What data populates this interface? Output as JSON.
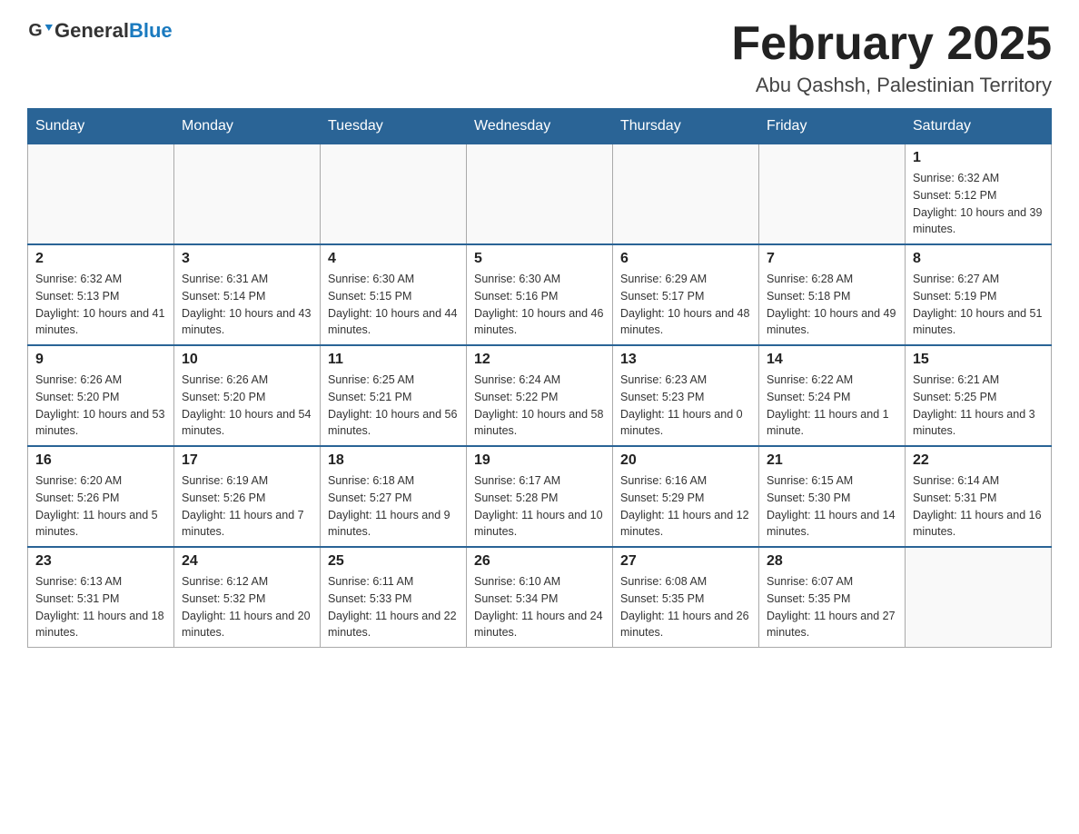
{
  "header": {
    "logo_general": "General",
    "logo_blue": "Blue",
    "month_title": "February 2025",
    "location": "Abu Qashsh, Palestinian Territory"
  },
  "weekdays": [
    "Sunday",
    "Monday",
    "Tuesday",
    "Wednesday",
    "Thursday",
    "Friday",
    "Saturday"
  ],
  "weeks": [
    [
      {
        "day": "",
        "info": ""
      },
      {
        "day": "",
        "info": ""
      },
      {
        "day": "",
        "info": ""
      },
      {
        "day": "",
        "info": ""
      },
      {
        "day": "",
        "info": ""
      },
      {
        "day": "",
        "info": ""
      },
      {
        "day": "1",
        "info": "Sunrise: 6:32 AM\nSunset: 5:12 PM\nDaylight: 10 hours and 39 minutes."
      }
    ],
    [
      {
        "day": "2",
        "info": "Sunrise: 6:32 AM\nSunset: 5:13 PM\nDaylight: 10 hours and 41 minutes."
      },
      {
        "day": "3",
        "info": "Sunrise: 6:31 AM\nSunset: 5:14 PM\nDaylight: 10 hours and 43 minutes."
      },
      {
        "day": "4",
        "info": "Sunrise: 6:30 AM\nSunset: 5:15 PM\nDaylight: 10 hours and 44 minutes."
      },
      {
        "day": "5",
        "info": "Sunrise: 6:30 AM\nSunset: 5:16 PM\nDaylight: 10 hours and 46 minutes."
      },
      {
        "day": "6",
        "info": "Sunrise: 6:29 AM\nSunset: 5:17 PM\nDaylight: 10 hours and 48 minutes."
      },
      {
        "day": "7",
        "info": "Sunrise: 6:28 AM\nSunset: 5:18 PM\nDaylight: 10 hours and 49 minutes."
      },
      {
        "day": "8",
        "info": "Sunrise: 6:27 AM\nSunset: 5:19 PM\nDaylight: 10 hours and 51 minutes."
      }
    ],
    [
      {
        "day": "9",
        "info": "Sunrise: 6:26 AM\nSunset: 5:20 PM\nDaylight: 10 hours and 53 minutes."
      },
      {
        "day": "10",
        "info": "Sunrise: 6:26 AM\nSunset: 5:20 PM\nDaylight: 10 hours and 54 minutes."
      },
      {
        "day": "11",
        "info": "Sunrise: 6:25 AM\nSunset: 5:21 PM\nDaylight: 10 hours and 56 minutes."
      },
      {
        "day": "12",
        "info": "Sunrise: 6:24 AM\nSunset: 5:22 PM\nDaylight: 10 hours and 58 minutes."
      },
      {
        "day": "13",
        "info": "Sunrise: 6:23 AM\nSunset: 5:23 PM\nDaylight: 11 hours and 0 minutes."
      },
      {
        "day": "14",
        "info": "Sunrise: 6:22 AM\nSunset: 5:24 PM\nDaylight: 11 hours and 1 minute."
      },
      {
        "day": "15",
        "info": "Sunrise: 6:21 AM\nSunset: 5:25 PM\nDaylight: 11 hours and 3 minutes."
      }
    ],
    [
      {
        "day": "16",
        "info": "Sunrise: 6:20 AM\nSunset: 5:26 PM\nDaylight: 11 hours and 5 minutes."
      },
      {
        "day": "17",
        "info": "Sunrise: 6:19 AM\nSunset: 5:26 PM\nDaylight: 11 hours and 7 minutes."
      },
      {
        "day": "18",
        "info": "Sunrise: 6:18 AM\nSunset: 5:27 PM\nDaylight: 11 hours and 9 minutes."
      },
      {
        "day": "19",
        "info": "Sunrise: 6:17 AM\nSunset: 5:28 PM\nDaylight: 11 hours and 10 minutes."
      },
      {
        "day": "20",
        "info": "Sunrise: 6:16 AM\nSunset: 5:29 PM\nDaylight: 11 hours and 12 minutes."
      },
      {
        "day": "21",
        "info": "Sunrise: 6:15 AM\nSunset: 5:30 PM\nDaylight: 11 hours and 14 minutes."
      },
      {
        "day": "22",
        "info": "Sunrise: 6:14 AM\nSunset: 5:31 PM\nDaylight: 11 hours and 16 minutes."
      }
    ],
    [
      {
        "day": "23",
        "info": "Sunrise: 6:13 AM\nSunset: 5:31 PM\nDaylight: 11 hours and 18 minutes."
      },
      {
        "day": "24",
        "info": "Sunrise: 6:12 AM\nSunset: 5:32 PM\nDaylight: 11 hours and 20 minutes."
      },
      {
        "day": "25",
        "info": "Sunrise: 6:11 AM\nSunset: 5:33 PM\nDaylight: 11 hours and 22 minutes."
      },
      {
        "day": "26",
        "info": "Sunrise: 6:10 AM\nSunset: 5:34 PM\nDaylight: 11 hours and 24 minutes."
      },
      {
        "day": "27",
        "info": "Sunrise: 6:08 AM\nSunset: 5:35 PM\nDaylight: 11 hours and 26 minutes."
      },
      {
        "day": "28",
        "info": "Sunrise: 6:07 AM\nSunset: 5:35 PM\nDaylight: 11 hours and 27 minutes."
      },
      {
        "day": "",
        "info": ""
      }
    ]
  ]
}
